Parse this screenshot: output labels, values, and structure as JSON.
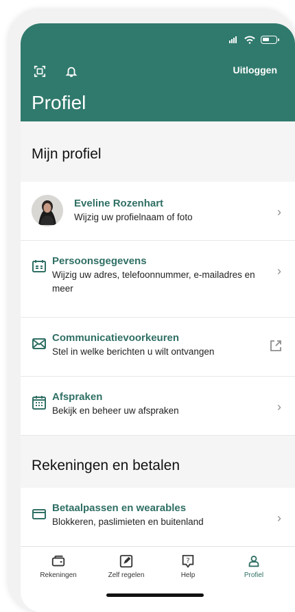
{
  "header": {
    "title": "Profiel",
    "logout_label": "Uitloggen"
  },
  "sections": [
    {
      "title": "Mijn profiel"
    },
    {
      "title": "Rekeningen en betalen"
    }
  ],
  "rows": [
    {
      "title": "Eveline Rozenhart",
      "subtitle": "Wijzig uw profielnaam of foto"
    },
    {
      "title": "Persoonsgegevens",
      "subtitle": "Wijzig uw adres, telefoonnummer, e-mailadres en meer"
    },
    {
      "title": "Communicatievoorkeuren",
      "subtitle": "Stel in welke berichten u wilt ontvangen"
    },
    {
      "title": "Afspraken",
      "subtitle": "Bekijk en beheer uw afspraken"
    },
    {
      "title": "Betaalpassen en wearables",
      "subtitle": "Blokkeren, paslimieten en buitenland"
    }
  ],
  "nav": [
    {
      "label": "Rekeningen",
      "icon": "wallet-icon"
    },
    {
      "label": "Zelf regelen",
      "icon": "edit-icon"
    },
    {
      "label": "Help",
      "icon": "help-icon"
    },
    {
      "label": "Profiel",
      "icon": "profile-icon"
    }
  ],
  "colors": {
    "brand": "#307a6d",
    "accent": "#2f6f64",
    "nav_active": "#2f6f64"
  }
}
